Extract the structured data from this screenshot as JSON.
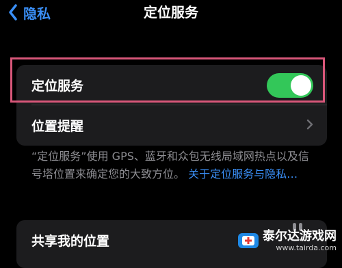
{
  "nav": {
    "back_label": "隐私",
    "title": "定位服务"
  },
  "settings": {
    "location_services": {
      "label": "定位服务",
      "enabled": true
    },
    "location_alerts": {
      "label": "位置提醒"
    }
  },
  "footer": {
    "text": "“定位服务”使用 GPS、蓝牙和众包无线局域网热点以及信号塔位置来确定您的大致方位。",
    "link": "关于定位服务与隐私…"
  },
  "share": {
    "label": "共享我的位置"
  },
  "watermark": {
    "name": "泰尔达游戏网",
    "url": "www.tairda.com"
  },
  "colors": {
    "accent": "#3a8ff7",
    "toggle_on": "#33c759",
    "highlight": "#d9577a"
  }
}
